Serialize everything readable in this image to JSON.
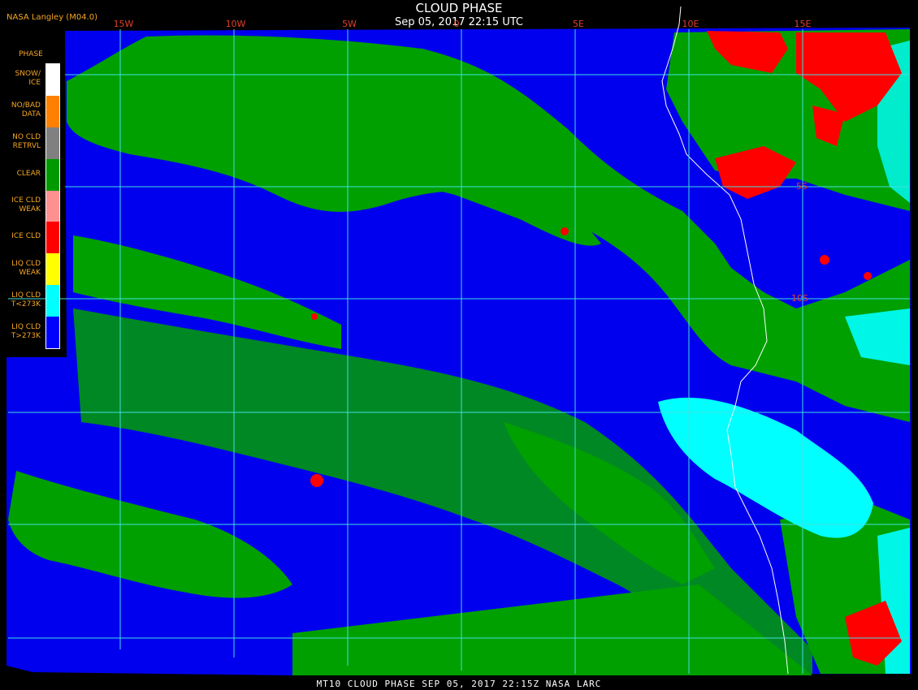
{
  "title": "CLOUD PHASE",
  "subtitle": "Sep 05, 2017 22:15 UTC",
  "producer": "NASA Langley (M04.0)",
  "footer": "MT10  CLOUD PHASE  SEP 05, 2017 22:15Z  NASA LARC",
  "longitude_labels": [
    "15W",
    "10W",
    "5W",
    "0",
    "5E",
    "10E",
    "15E"
  ],
  "latitude_labels": [
    "5S",
    "10S"
  ],
  "legend": {
    "title": "PHASE",
    "items": [
      {
        "label": "SNOW/\nICE",
        "color": "#ffffff"
      },
      {
        "label": "NO/BAD\nDATA",
        "color": "#ff8000"
      },
      {
        "label": "NO CLD\nRETRVL",
        "color": "#808080"
      },
      {
        "label": "CLEAR",
        "color": "#009900"
      },
      {
        "label": "ICE CLD\nWEAK",
        "color": "#ff9090"
      },
      {
        "label": "ICE CLD",
        "color": "#ff0000"
      },
      {
        "label": "LIQ CLD\nWEAK",
        "color": "#ffff00"
      },
      {
        "label": "LIQ CLD\nT<273K",
        "color": "#00ffff"
      },
      {
        "label": "LIQ CLD\nT>273K",
        "color": "#0000ff"
      }
    ]
  },
  "colors": {
    "ocean_cloud": "#0000ee",
    "clear": "#00a000",
    "ice": "#ff0000",
    "liquid_cold": "#00ffff",
    "grid": "#40e0e0",
    "coastline": "#ffffff",
    "label": "#f5a623"
  }
}
